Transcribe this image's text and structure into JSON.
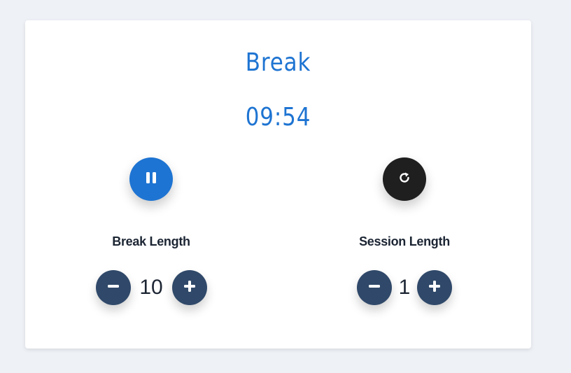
{
  "timer": {
    "label": "Break",
    "time": "09:54"
  },
  "controls": {
    "play_pause_icon": "pause-icon",
    "reset_icon": "refresh-icon"
  },
  "break_length": {
    "label": "Break Length",
    "value": "10"
  },
  "session_length": {
    "label": "Session Length",
    "value": "1"
  },
  "colors": {
    "accent": "#1e74d2",
    "stepper": "#30496a",
    "reset": "#1f1f1f",
    "background": "#eef1f6"
  }
}
